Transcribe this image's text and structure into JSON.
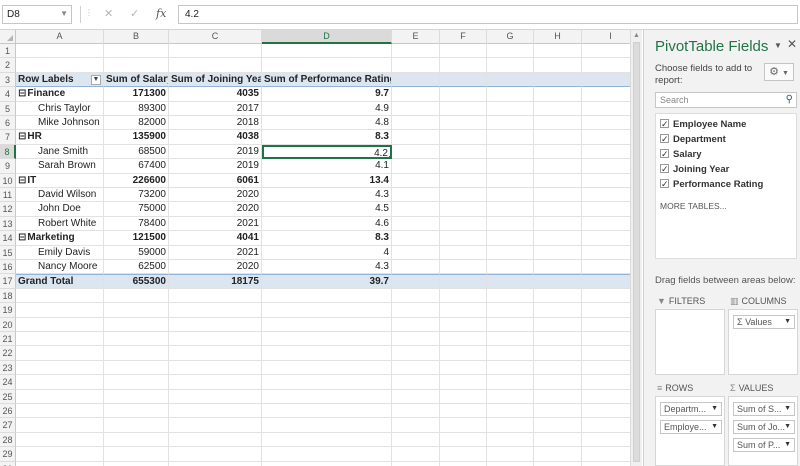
{
  "formula_bar": {
    "name_box": "D8",
    "cancel_icon": "✕",
    "enter_icon": "✓",
    "fx_label": "fx",
    "formula_value": "4.2"
  },
  "columns": [
    "A",
    "B",
    "C",
    "D",
    "E",
    "F",
    "G",
    "H",
    "I"
  ],
  "selected_column": "D",
  "row_numbers": [
    "1",
    "2",
    "3",
    "4",
    "5",
    "6",
    "7",
    "8",
    "9",
    "10",
    "11",
    "12",
    "13",
    "14",
    "15",
    "16",
    "17",
    "18",
    "19",
    "20",
    "21",
    "22",
    "23",
    "24",
    "25",
    "26",
    "27",
    "28",
    "29",
    "30"
  ],
  "selected_row": "8",
  "pivot_table": {
    "headers": [
      "Row Labels",
      "Sum of Salary",
      "Sum of Joining Year",
      "Sum of Performance Rating"
    ],
    "rows": [
      {
        "row": "4",
        "type": "group",
        "label": "Finance",
        "salary": "171300",
        "year": "4035",
        "rating": "9.7"
      },
      {
        "row": "5",
        "type": "item",
        "label": "Chris Taylor",
        "salary": "89300",
        "year": "2017",
        "rating": "4.9"
      },
      {
        "row": "6",
        "type": "item",
        "label": "Mike Johnson",
        "salary": "82000",
        "year": "2018",
        "rating": "4.8"
      },
      {
        "row": "7",
        "type": "group",
        "label": "HR",
        "salary": "135900",
        "year": "4038",
        "rating": "8.3"
      },
      {
        "row": "8",
        "type": "item",
        "label": "Jane Smith",
        "salary": "68500",
        "year": "2019",
        "rating": "4.2"
      },
      {
        "row": "9",
        "type": "item",
        "label": "Sarah Brown",
        "salary": "67400",
        "year": "2019",
        "rating": "4.1"
      },
      {
        "row": "10",
        "type": "group",
        "label": "IT",
        "salary": "226600",
        "year": "6061",
        "rating": "13.4"
      },
      {
        "row": "11",
        "type": "item",
        "label": "David Wilson",
        "salary": "73200",
        "year": "2020",
        "rating": "4.3"
      },
      {
        "row": "12",
        "type": "item",
        "label": "John Doe",
        "salary": "75000",
        "year": "2020",
        "rating": "4.5"
      },
      {
        "row": "13",
        "type": "item",
        "label": "Robert White",
        "salary": "78400",
        "year": "2021",
        "rating": "4.6"
      },
      {
        "row": "14",
        "type": "group",
        "label": "Marketing",
        "salary": "121500",
        "year": "4041",
        "rating": "8.3"
      },
      {
        "row": "15",
        "type": "item",
        "label": "Emily Davis",
        "salary": "59000",
        "year": "2021",
        "rating": "4"
      },
      {
        "row": "16",
        "type": "item",
        "label": "Nancy Moore",
        "salary": "62500",
        "year": "2020",
        "rating": "4.3"
      }
    ],
    "grand_total": {
      "label": "Grand Total",
      "salary": "655300",
      "year": "18175",
      "rating": "39.7"
    }
  },
  "pivot_panel": {
    "title": "PivotTable Fields",
    "choose_text": "Choose fields to add to report:",
    "search_placeholder": "Search",
    "fields": [
      "Employee Name",
      "Department",
      "Salary",
      "Joining Year",
      "Performance Rating"
    ],
    "more_tables": "MORE TABLES...",
    "drag_text": "Drag fields between areas below:",
    "filters_label": "FILTERS",
    "columns_label": "COLUMNS",
    "rows_label": "ROWS",
    "values_label": "VALUES",
    "columns_chips": [
      "Σ Values"
    ],
    "rows_chips": [
      "Departm...",
      "Employe..."
    ],
    "values_chips": [
      "Sum of S...",
      "Sum of Jo...",
      "Sum of P..."
    ]
  }
}
